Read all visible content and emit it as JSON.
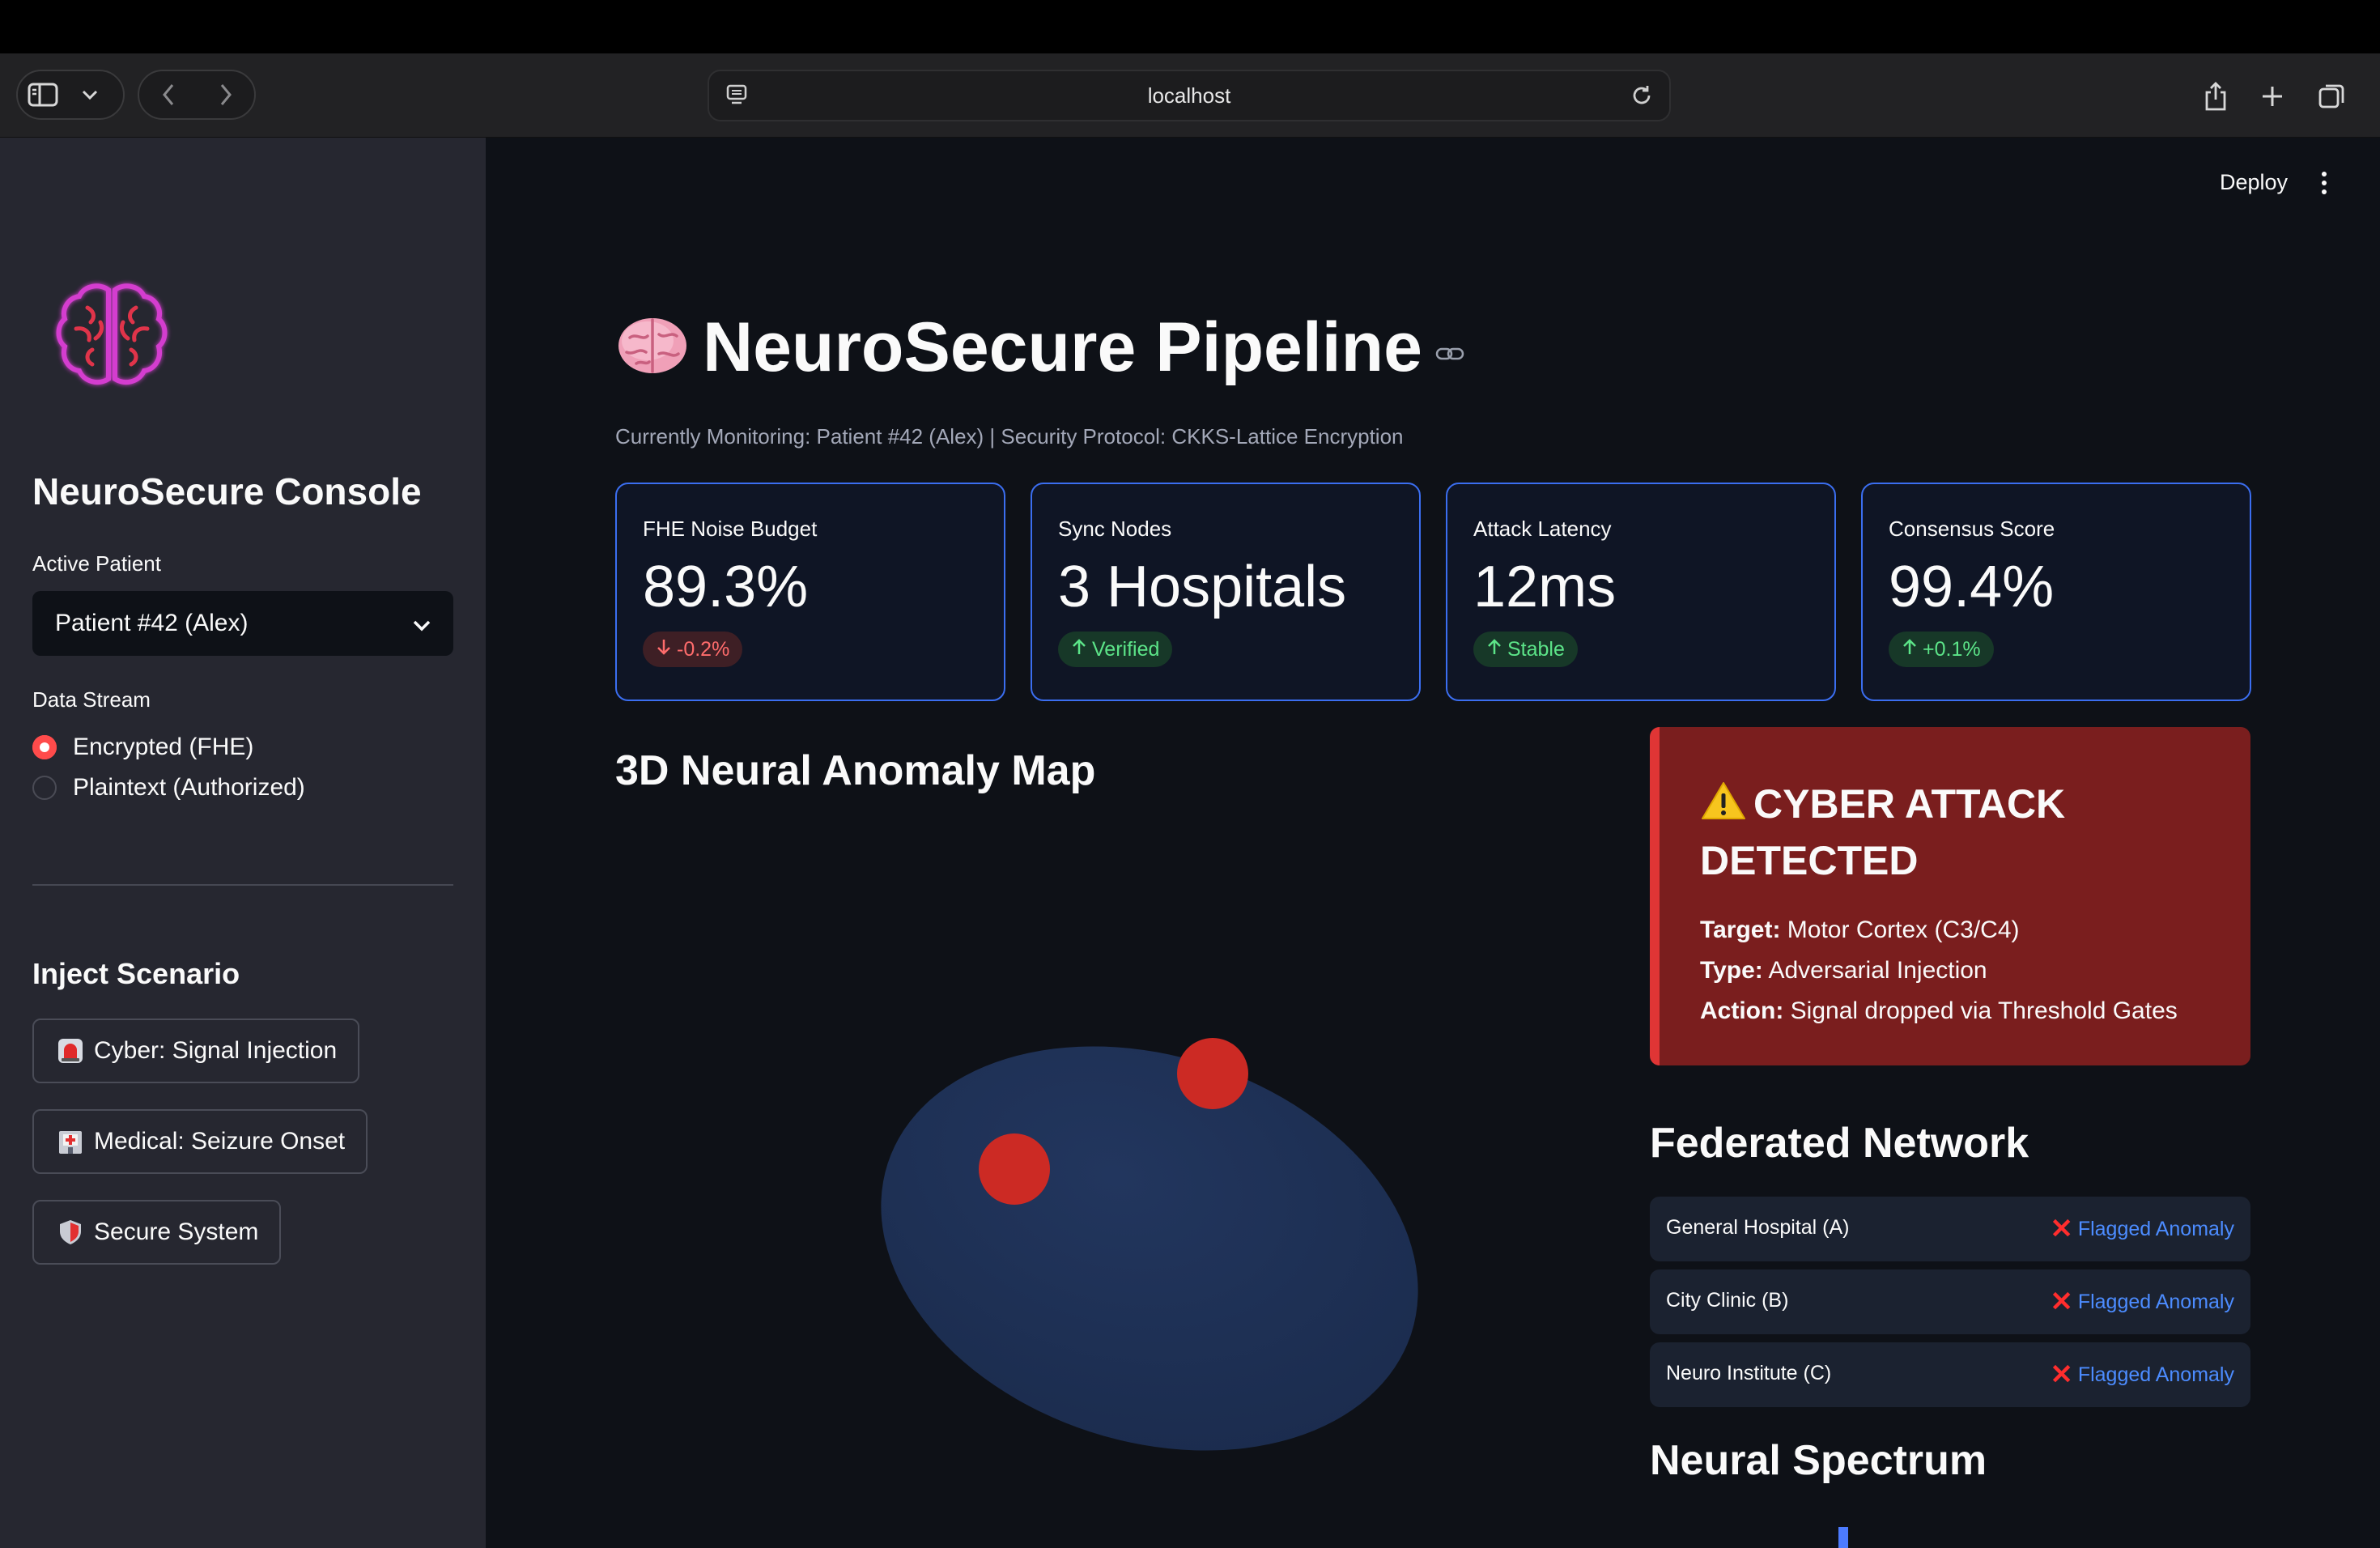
{
  "browser": {
    "url": "localhost"
  },
  "header": {
    "deploy_label": "Deploy"
  },
  "sidebar": {
    "title": "NeuroSecure Console",
    "active_patient_label": "Active Patient",
    "active_patient_value": "Patient #42 (Alex)",
    "data_stream_label": "Data Stream",
    "data_stream_options": [
      {
        "label": "Encrypted (FHE)",
        "selected": true
      },
      {
        "label": "Plaintext (Authorized)",
        "selected": false
      }
    ],
    "inject_title": "Inject Scenario",
    "buttons": [
      {
        "label": "Cyber: Signal Injection",
        "icon": "siren-icon"
      },
      {
        "label": "Medical: Seizure Onset",
        "icon": "hospital-icon"
      },
      {
        "label": "Secure System",
        "icon": "shield-icon"
      }
    ]
  },
  "main": {
    "title": "NeuroSecure Pipeline",
    "caption": "Currently Monitoring: Patient #42 (Alex) | Security Protocol: CKKS-Lattice Encryption",
    "metrics": [
      {
        "label": "FHE Noise Budget",
        "value": "89.3%",
        "delta": "-0.2%",
        "direction": "down"
      },
      {
        "label": "Sync Nodes",
        "value": "3 Hospitals",
        "delta": "Verified",
        "direction": "up"
      },
      {
        "label": "Attack Latency",
        "value": "12ms",
        "delta": "Stable",
        "direction": "up"
      },
      {
        "label": "Consensus Score",
        "value": "99.4%",
        "delta": "+0.1%",
        "direction": "up"
      }
    ],
    "map_title": "3D Neural Anomaly Map",
    "alert": {
      "title": "CYBER ATTACK DETECTED",
      "target_label": "Target:",
      "target_value": "Motor Cortex (C3/C4)",
      "type_label": "Type:",
      "type_value": "Adversarial Injection",
      "action_label": "Action:",
      "action_value": "Signal dropped via Threshold Gates"
    },
    "federated_title": "Federated Network",
    "federated_nodes": [
      {
        "name": "General Hospital (A)",
        "status": "Flagged Anomaly"
      },
      {
        "name": "City Clinic (B)",
        "status": "Flagged Anomaly"
      },
      {
        "name": "Neuro Institute (C)",
        "status": "Flagged Anomaly"
      }
    ],
    "spectrum_title": "Neural Spectrum"
  },
  "colors": {
    "accent_red": "#ff4b4b",
    "metric_border": "#3b6ef0",
    "alert_bg": "#7a1e1e",
    "anomaly_dot": "#cc2a24",
    "brain_surface": "#1e3258"
  }
}
